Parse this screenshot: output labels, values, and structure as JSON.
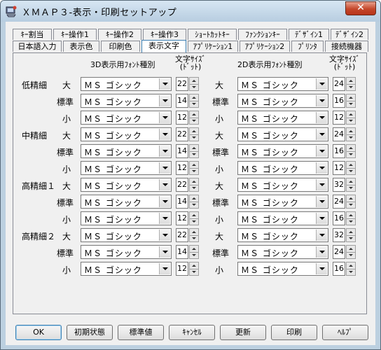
{
  "window": {
    "title": "ＸＭＡＰ３-表示・印刷セットアップ",
    "close_label": "✕"
  },
  "tabs_row1": [
    "ｷｰ割当",
    "ｷｰ操作1",
    "ｷｰ操作2",
    "ｷｰ操作3",
    "ｼｮｰﾄｶｯﾄｷｰ",
    "ﾌｧﾝｸｼｮﾝｷｰ",
    "ﾃﾞｻﾞｲﾝ1",
    "ﾃﾞｻﾞｲﾝ2"
  ],
  "tabs_row2": [
    "日本語入力",
    "表示色",
    "印刷色",
    "表示文字",
    "ｱﾌﾟﾘｹｰｼｮﾝ1",
    "ｱﾌﾟﾘｹｰｼｮﾝ2",
    "ﾌﾟﾘﾝﾀ",
    "接続機器"
  ],
  "active_tab": "表示文字",
  "headers": {
    "font3d": "3D表示用ﾌｫﾝﾄ種別",
    "size3d": "文字ｻｲｽﾞ",
    "dot3d": "(ﾄﾞｯﾄ)",
    "font2d": "2D表示用ﾌｫﾝﾄ種別",
    "size2d": "文字ｻｲｽﾞ",
    "dot2d": "(ﾄﾞｯﾄ)"
  },
  "levels": [
    "低精細",
    "中精細",
    "高精細１",
    "高精細２"
  ],
  "rows": [
    {
      "size": "大",
      "font3d": "ＭＳ ゴシック",
      "size3d": "22",
      "font2d": "ＭＳ ゴシック",
      "size2d": "24"
    },
    {
      "size": "標準",
      "font3d": "ＭＳ ゴシック",
      "size3d": "14",
      "font2d": "ＭＳ ゴシック",
      "size2d": "16"
    },
    {
      "size": "小",
      "font3d": "ＭＳ ゴシック",
      "size3d": "12",
      "font2d": "ＭＳ ゴシック",
      "size2d": "12"
    },
    {
      "size": "大",
      "font3d": "ＭＳ ゴシック",
      "size3d": "22",
      "font2d": "ＭＳ ゴシック",
      "size2d": "24"
    },
    {
      "size": "標準",
      "font3d": "ＭＳ ゴシック",
      "size3d": "14",
      "font2d": "ＭＳ ゴシック",
      "size2d": "16"
    },
    {
      "size": "小",
      "font3d": "ＭＳ ゴシック",
      "size3d": "12",
      "font2d": "ＭＳ ゴシック",
      "size2d": "12"
    },
    {
      "size": "大",
      "font3d": "ＭＳ ゴシック",
      "size3d": "22",
      "font2d": "ＭＳ ゴシック",
      "size2d": "32"
    },
    {
      "size": "標準",
      "font3d": "ＭＳ ゴシック",
      "size3d": "14",
      "font2d": "ＭＳ ゴシック",
      "size2d": "24"
    },
    {
      "size": "小",
      "font3d": "ＭＳ ゴシック",
      "size3d": "12",
      "font2d": "ＭＳ ゴシック",
      "size2d": "16"
    },
    {
      "size": "大",
      "font3d": "ＭＳ ゴシック",
      "size3d": "22",
      "font2d": "ＭＳ ゴシック",
      "size2d": "32"
    },
    {
      "size": "標準",
      "font3d": "ＭＳ ゴシック",
      "size3d": "14",
      "font2d": "ＭＳ ゴシック",
      "size2d": "24"
    },
    {
      "size": "小",
      "font3d": "ＭＳ ゴシック",
      "size3d": "12",
      "font2d": "ＭＳ ゴシック",
      "size2d": "16"
    }
  ],
  "buttons": [
    "OK",
    "初期状態",
    "標準値",
    "ｷｬﾝｾﾙ",
    "更新",
    "印刷",
    "ﾍﾙﾌﾟ"
  ]
}
